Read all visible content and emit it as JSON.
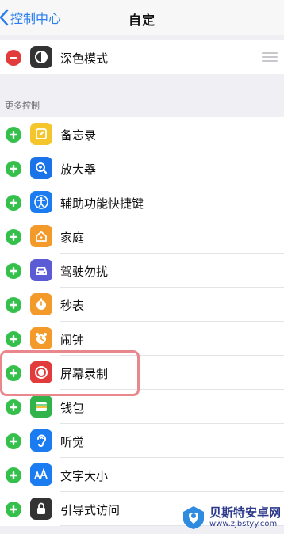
{
  "nav": {
    "back_label": "控制中心",
    "title": "自定"
  },
  "included": [
    {
      "label": "深色模式",
      "icon": "dark-mode-icon",
      "icon_bg": "#333333"
    }
  ],
  "section_header": "更多控制",
  "more_controls": [
    {
      "label": "备忘录",
      "icon": "notes-icon",
      "icon_bg": "#f5c52c"
    },
    {
      "label": "放大器",
      "icon": "magnifier-icon",
      "icon_bg": "#1a73e8"
    },
    {
      "label": "辅助功能快捷键",
      "icon": "accessibility-icon",
      "icon_bg": "#1a7cf0"
    },
    {
      "label": "家庭",
      "icon": "home-icon",
      "icon_bg": "#f39a2a"
    },
    {
      "label": "驾驶勿扰",
      "icon": "car-icon",
      "icon_bg": "#5b5bd6"
    },
    {
      "label": "秒表",
      "icon": "stopwatch-icon",
      "icon_bg": "#f39a2a"
    },
    {
      "label": "闹钟",
      "icon": "alarm-icon",
      "icon_bg": "#f39a2a"
    },
    {
      "label": "屏幕录制",
      "icon": "screen-record-icon",
      "icon_bg": "#e23b3b"
    },
    {
      "label": "钱包",
      "icon": "wallet-icon",
      "icon_bg": "#2fb34a"
    },
    {
      "label": "听觉",
      "icon": "hearing-icon",
      "icon_bg": "#1a7cf0"
    },
    {
      "label": "文字大小",
      "icon": "text-size-icon",
      "icon_bg": "#1a7cf0"
    },
    {
      "label": "引导式访问",
      "icon": "guided-access-icon",
      "icon_bg": "#333333"
    }
  ],
  "watermark": {
    "name": "贝斯特安卓网",
    "url": "www.zjbstyy.com"
  },
  "colors": {
    "accent": "#2a7ef0",
    "add": "#35c04c",
    "remove": "#e23b3b",
    "highlight": "#e9878d"
  }
}
